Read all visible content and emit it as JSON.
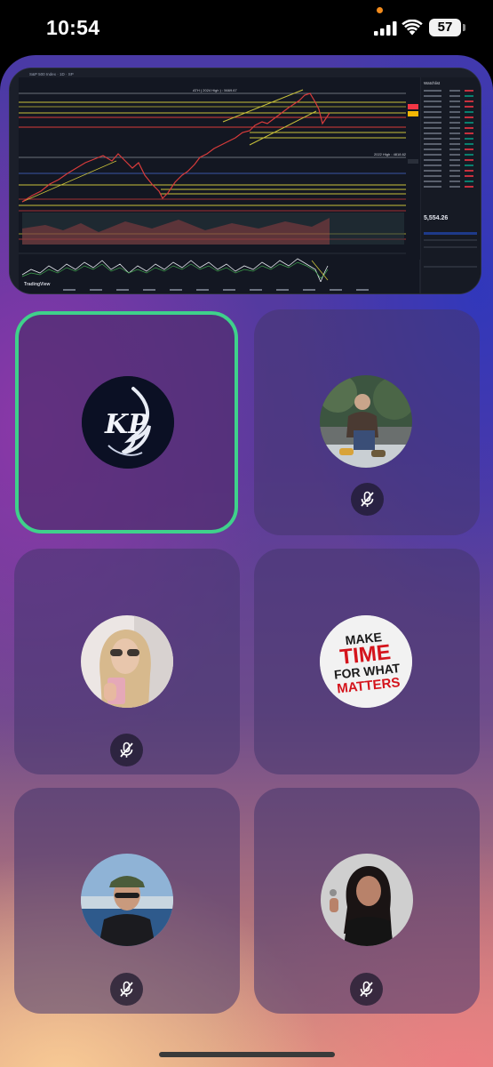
{
  "status_bar": {
    "time": "10:54",
    "battery": "57"
  },
  "screen_share": {
    "watermark": "TradingView",
    "symbol_header": "S&P 500 Index · 1D · SP",
    "watchlist_title": "Watchlist",
    "quote_value": "5,554.26",
    "ath_label": "ATH ( 2024 High ) : 5669.67",
    "low_label": "2022 High : 4818.62"
  },
  "participants": [
    {
      "name": "host-logo",
      "initials": "KP",
      "active": true,
      "muted": false
    },
    {
      "name": "participant-2",
      "muted": true
    },
    {
      "name": "participant-3",
      "muted": true
    },
    {
      "name": "participant-4",
      "avatar_text": [
        "MAKE",
        "TIME",
        "FOR WHAT",
        "MATTERS"
      ],
      "muted": false
    },
    {
      "name": "participant-5",
      "muted": true
    },
    {
      "name": "participant-6",
      "muted": true
    }
  ],
  "colors": {
    "active_border": "#3fd18b",
    "accent_orange": "#f28b1c"
  },
  "icons": [
    "signal-icon",
    "wifi-icon",
    "battery-icon",
    "mic-off-icon"
  ]
}
